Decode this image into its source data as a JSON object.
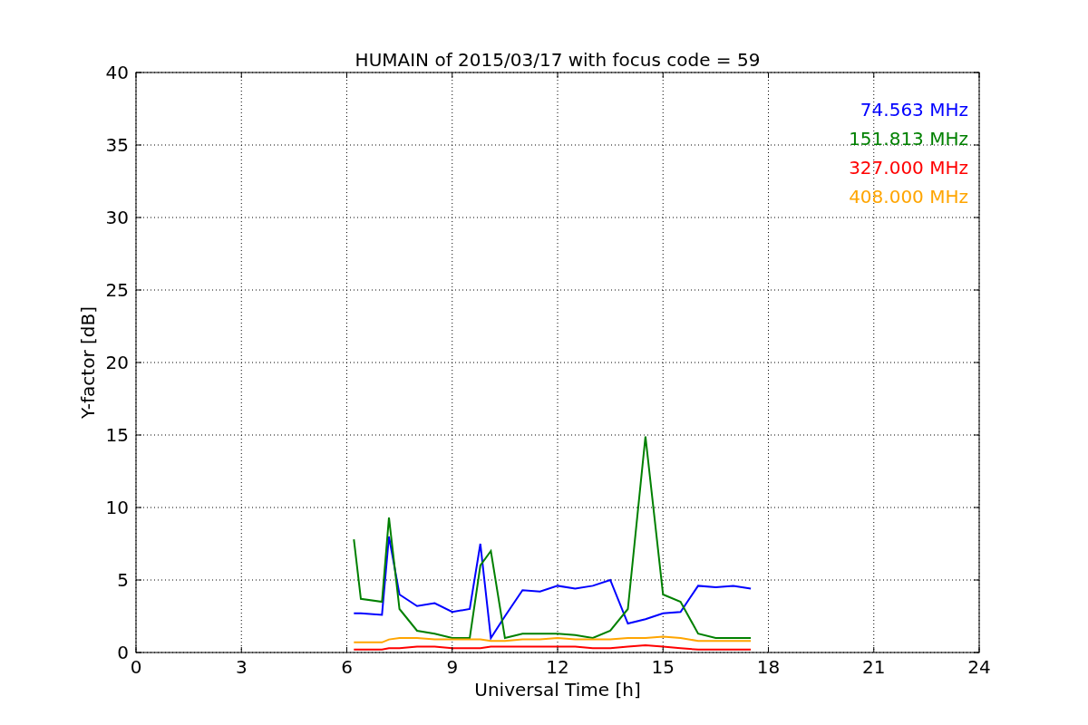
{
  "chart_data": {
    "type": "line",
    "title": "HUMAIN of 2015/03/17 with focus code = 59",
    "xlabel": "Universal Time [h]",
    "ylabel": "Y-factor [dB]",
    "x": [
      6.2,
      6.4,
      7.0,
      7.2,
      7.5,
      8,
      8.5,
      9,
      9.5,
      9.8,
      10.1,
      10.5,
      11,
      11.5,
      12,
      12.5,
      13,
      13.5,
      14,
      14.5,
      15,
      15.5,
      16,
      16.5,
      17,
      17.5
    ],
    "series": [
      {
        "name": "74.563 MHz",
        "color": "#0000ff",
        "values": [
          2.7,
          2.7,
          2.6,
          8,
          4,
          3.2,
          3.4,
          2.8,
          3,
          7.5,
          1,
          2.5,
          4.3,
          4.2,
          4.6,
          4.4,
          4.6,
          5,
          2,
          2.3,
          2.7,
          2.8,
          4.6,
          4.5,
          4.6,
          4.4
        ]
      },
      {
        "name": "151.813 MHz",
        "color": "#008000",
        "values": [
          7.8,
          3.7,
          3.5,
          9.3,
          3,
          1.5,
          1.3,
          1,
          1,
          6,
          7,
          1,
          1.3,
          1.3,
          1.3,
          1.2,
          1,
          1.5,
          3,
          14.9,
          4,
          3.5,
          1.3,
          1,
          1,
          1
        ]
      },
      {
        "name": "327.000 MHz",
        "color": "#ff0000",
        "values": [
          0.2,
          0.2,
          0.2,
          0.3,
          0.3,
          0.4,
          0.4,
          0.3,
          0.3,
          0.3,
          0.4,
          0.4,
          0.4,
          0.4,
          0.4,
          0.4,
          0.3,
          0.3,
          0.4,
          0.5,
          0.4,
          0.3,
          0.2,
          0.2,
          0.2,
          0.2
        ]
      },
      {
        "name": "408.000 MHz",
        "color": "#ffa500",
        "values": [
          0.7,
          0.7,
          0.7,
          0.9,
          1,
          1,
          0.9,
          0.9,
          0.9,
          0.9,
          0.8,
          0.8,
          0.9,
          0.9,
          1,
          0.9,
          0.9,
          0.9,
          1,
          1,
          1.1,
          1,
          0.8,
          0.8,
          0.8,
          0.8
        ]
      }
    ],
    "xlim": [
      0,
      24
    ],
    "ylim": [
      0,
      40
    ],
    "xticks": [
      0,
      3,
      6,
      9,
      12,
      15,
      18,
      21,
      24
    ],
    "yticks": [
      0,
      5,
      10,
      15,
      20,
      25,
      30,
      35,
      40
    ],
    "grid": true
  }
}
